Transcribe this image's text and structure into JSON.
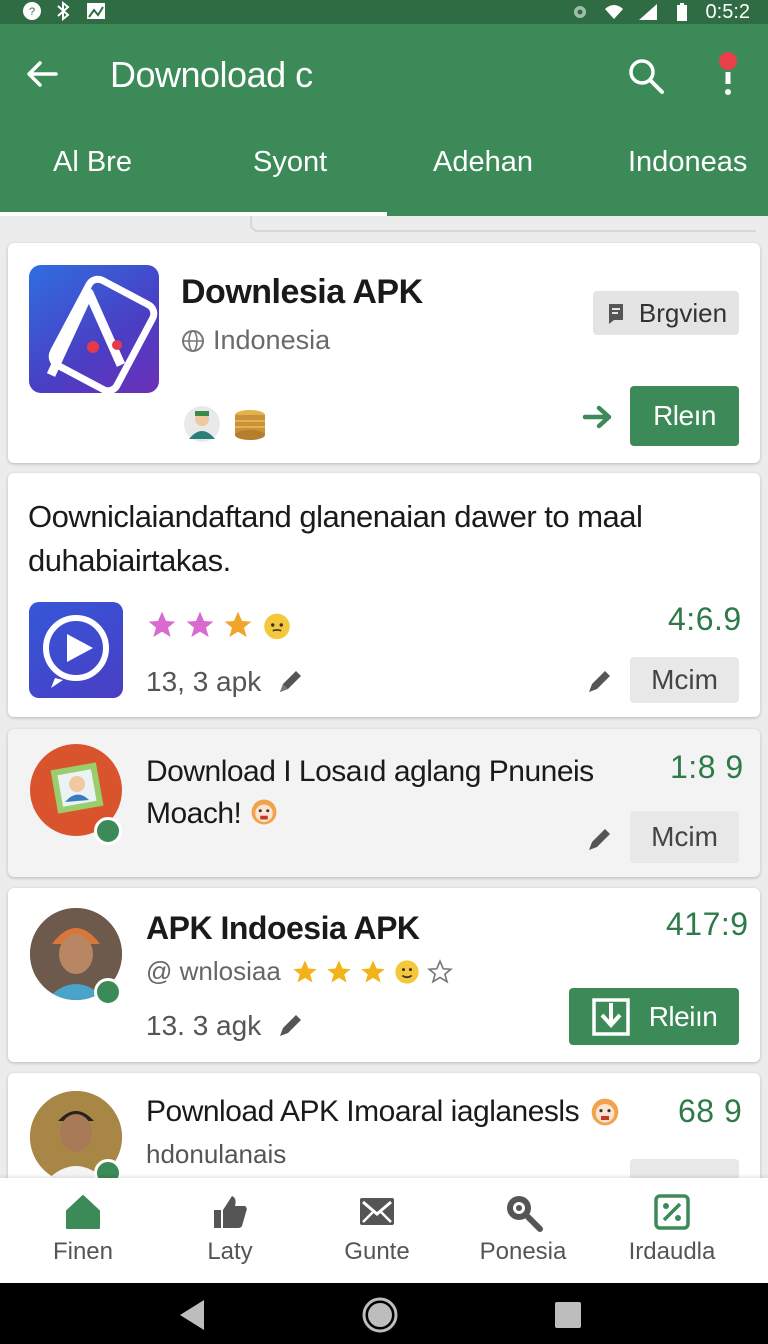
{
  "status_bar": {
    "time": "0:5:2"
  },
  "app_bar": {
    "title": "Downoload c",
    "tabs": [
      {
        "label": "Al Bre",
        "active": true
      },
      {
        "label": "Syont",
        "active": false
      },
      {
        "label": "Adehan",
        "active": false
      },
      {
        "label": "Indoneas",
        "active": false
      }
    ]
  },
  "cards": [
    {
      "title": "Downlesia APK",
      "subtitle": "Indonesia",
      "chip_label": "Brgvien",
      "button_label": "Rleın"
    },
    {
      "description": "Oowniclaiandaftand glanenaian dawer to maal duhabiairtakas.",
      "rating": "4:6.9",
      "meta": "13, 3 apk",
      "button_label": "Mcim"
    },
    {
      "title": "Download I Losaıd aglang Pnuneis Moach!",
      "rating": "1:8 9",
      "button_label": "Mcim"
    },
    {
      "title": "APK Indoesia APK",
      "subtitle": "@ wnlosiaa",
      "rating": "417:9",
      "meta": "13. 3 agk",
      "button_label": "Rleiın"
    },
    {
      "title": "Pownload APK Imoaral iaglanesls",
      "subtitle": "hdonulanais",
      "rating": "68 9"
    }
  ],
  "bottom_nav": [
    {
      "label": "Finen",
      "icon": "home-icon",
      "active": true
    },
    {
      "label": "Laty",
      "icon": "thumbs-up-icon",
      "active": false
    },
    {
      "label": "Gunte",
      "icon": "mail-icon",
      "active": false
    },
    {
      "label": "Ponesia",
      "icon": "search-icon",
      "active": false
    },
    {
      "label": "Irdaudla",
      "icon": "percent-icon",
      "active": false
    }
  ],
  "colors": {
    "primary": "#3b8a57",
    "primary_dark": "#2f6b43",
    "accent_text": "#2f7a49"
  }
}
